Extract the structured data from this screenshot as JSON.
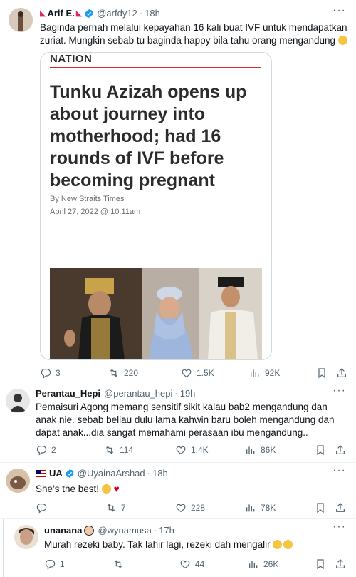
{
  "tweets": [
    {
      "name": "Arif E.",
      "handle": "@arfdy12",
      "time": "18h",
      "text": "Baginda pernah melalui kepayahan 16 kali buat IVF untuk mendapatkan zuriat. Mungkin sebab tu baginda happy bila tahu orang mengandung",
      "replies": "3",
      "retweets": "220",
      "likes": "1.5K",
      "views": "92K"
    },
    {
      "name": "Perantau_Hepi",
      "handle": "@perantau_hepi",
      "time": "19h",
      "text": "Pemaisuri Agong memang sensitif sikit kalau bab2 mengandung dan anak nie. sebab beliau dulu lama kahwin baru boleh mengandung dan dapat anak...dia sangat memahami perasaan ibu mengandung..",
      "replies": "2",
      "retweets": "114",
      "likes": "1.4K",
      "views": "86K"
    },
    {
      "name": "UA",
      "handle": "@UyainaArshad",
      "time": "18h",
      "text": "She’s the best!",
      "replies": "",
      "retweets": "7",
      "likes": "228",
      "views": "78K"
    },
    {
      "name": "unanana",
      "handle": "@wynamusa",
      "time": "17h",
      "text": "Murah rezeki baby. Tak lahir lagi, rezeki dah mengalir",
      "replies": "1",
      "retweets": "",
      "likes": "44",
      "views": "26K"
    }
  ],
  "article": {
    "section": "NATION",
    "headline": "Tunku Azizah opens up about journey into motherhood; had 16 rounds of IVF before becoming pregnant",
    "byline": "By New Straits Times",
    "date": "April 27, 2022 @ 10:11am"
  },
  "separator": "·",
  "colors": {
    "verified": "#1d9bf0",
    "muted": "#536471",
    "accent_red": "#d62a2a"
  }
}
